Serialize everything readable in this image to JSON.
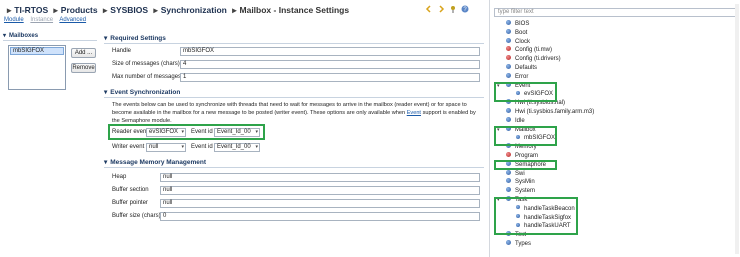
{
  "breadcrumb": [
    {
      "label": "TI-RTOS",
      "active": false
    },
    {
      "label": "Products",
      "active": false
    },
    {
      "label": "SYSBIOS",
      "active": false
    },
    {
      "label": "Synchronization",
      "active": false
    },
    {
      "label": "Mailbox - Instance Settings",
      "active": true
    }
  ],
  "subtabs": [
    {
      "label": "Module",
      "disabled": false
    },
    {
      "label": "Instance",
      "disabled": true
    },
    {
      "label": "Advanced",
      "disabled": false
    }
  ],
  "toolbar_icons": [
    "back-arrow-icon",
    "forward-arrow-icon",
    "pin-icon",
    "help-icon"
  ],
  "mailboxes": {
    "header": "Mailboxes",
    "items": [
      "mbSIGFOX"
    ],
    "add_label": "Add ...",
    "remove_label": "Remove"
  },
  "required_settings": {
    "title": "Required Settings",
    "handle_label": "Handle",
    "handle_value": "mbSIGFOX",
    "size_label": "Size of messages (chars)",
    "size_value": "4",
    "max_label": "Max number of messages",
    "max_value": "1"
  },
  "event_sync": {
    "title": "Event Synchronization",
    "desc_part1": "The events below can be used to synchronize with threads that need to wait for messages to arrive in the mailbox (reader event) or for space to become available in the mailbox for a new message to be posted (writer event). These options are only available when",
    "desc_link": "Event",
    "desc_part2": "support is enabled by the Semaphore module.",
    "reader_label": "Reader event",
    "reader_value": "evSIGFOX",
    "reader_id_label": "Event id",
    "reader_id_value": "Event_Id_00",
    "writer_label": "Writer event",
    "writer_value": "null",
    "writer_id_label": "Event id",
    "writer_id_value": "Event_Id_00"
  },
  "memory": {
    "title": "Message Memory Management",
    "heap_label": "Heap",
    "heap_value": "null",
    "section_label": "Buffer section",
    "section_value": "null",
    "pointer_label": "Buffer pointer",
    "pointer_value": "null",
    "bufsize_label": "Buffer size (chars)",
    "bufsize_value": "0"
  },
  "outline": {
    "filter_placeholder": "type filter text",
    "items": [
      {
        "label": "BIOS",
        "color": "blue",
        "level": 0
      },
      {
        "label": "Boot",
        "color": "blue",
        "level": 0
      },
      {
        "label": "Clock",
        "color": "blue",
        "level": 0
      },
      {
        "label": "Config (ti.mw)",
        "color": "red",
        "level": 0
      },
      {
        "label": "Config (ti.drivers)",
        "color": "red",
        "level": 0
      },
      {
        "label": "Defaults",
        "color": "blue",
        "level": 0
      },
      {
        "label": "Error",
        "color": "blue",
        "level": 0
      },
      {
        "label": "Event",
        "color": "blue",
        "level": 0,
        "expanded": true
      },
      {
        "label": "evSIGFOX",
        "color": "blue",
        "level": 1
      },
      {
        "label": "Hwi (ti.sysbios.hal)",
        "color": "blue",
        "level": 0
      },
      {
        "label": "Hwi (ti.sysbios.family.arm.m3)",
        "color": "blue",
        "level": 0
      },
      {
        "label": "Idle",
        "color": "blue",
        "level": 0
      },
      {
        "label": "Mailbox",
        "color": "blue",
        "level": 0,
        "expanded": true
      },
      {
        "label": "mbSIGFOX",
        "color": "blue",
        "level": 1
      },
      {
        "label": "Memory",
        "color": "blue",
        "level": 0
      },
      {
        "label": "Program",
        "color": "red",
        "level": 0
      },
      {
        "label": "Semaphore",
        "color": "blue",
        "level": 0
      },
      {
        "label": "Swi",
        "color": "blue",
        "level": 0
      },
      {
        "label": "SysMin",
        "color": "blue",
        "level": 0
      },
      {
        "label": "System",
        "color": "blue",
        "level": 0
      },
      {
        "label": "Task",
        "color": "blue",
        "level": 0,
        "expanded": true
      },
      {
        "label": "handleTaskBeacon",
        "color": "blue",
        "level": 1
      },
      {
        "label": "handleTaskSigfox",
        "color": "blue",
        "level": 1
      },
      {
        "label": "handleTaskUART",
        "color": "blue",
        "level": 1
      },
      {
        "label": "Text",
        "color": "blue",
        "level": 0
      },
      {
        "label": "Types",
        "color": "blue",
        "level": 0
      }
    ]
  },
  "colors": {
    "highlight_box": "#2ea34a",
    "section_title": "#1d3a63",
    "link": "#1a5aa8"
  }
}
